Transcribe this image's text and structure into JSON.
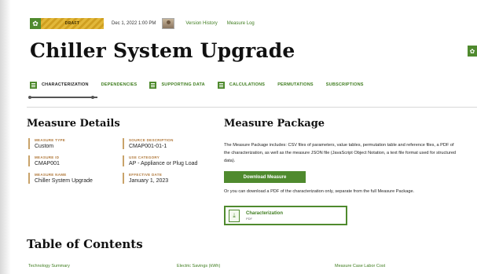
{
  "topbar": {
    "status_badge": "DRAFT",
    "datetime": "Dec 1, 2022 1:00 PM",
    "version_history_label": "Version History",
    "measure_log_label": "Measure Log"
  },
  "page": {
    "title": "Chiller System Upgrade"
  },
  "tabs": [
    {
      "label": "CHARACTERIZATION",
      "has_icon": true,
      "active": true
    },
    {
      "label": "DEPENDENCIES",
      "has_icon": false
    },
    {
      "label": "SUPPORTING DATA",
      "has_icon": true
    },
    {
      "label": "CALCULATIONS",
      "has_icon": true
    },
    {
      "label": "PERMUTATIONS",
      "has_icon": false
    },
    {
      "label": "SUBSCRIPTIONS",
      "has_icon": false
    }
  ],
  "measure_details": {
    "heading": "Measure Details",
    "fields": [
      {
        "label": "MEASURE TYPE",
        "value": "Custom"
      },
      {
        "label": "MEASURE ID",
        "value": "CMAP001"
      },
      {
        "label": "MEASURE NAME",
        "value": "Chiller System Upgrade"
      },
      {
        "label": "SOURCE DESCRIPTION",
        "value": "CMAP001-01-1"
      },
      {
        "label": "USE CATEGORY",
        "value": "AP - Appliance or Plug Load"
      },
      {
        "label": "EFFECTIVE DATE",
        "value": "January 1, 2023"
      }
    ]
  },
  "measure_package": {
    "heading": "Measure Package",
    "description": "The Measure Package includes: CSV files of parameters, value tables, permutation table and reference files, a PDF of the characterization, as well as the measure JSON file (JavaScript Object Notation, a text file format used for structured data).",
    "download_label": "Download Measure",
    "alt_text": "Or you can download a PDF of the characterization only, separate from the full Measure Package.",
    "pdf_card": {
      "title": "Characterization",
      "subtitle": "PDF"
    }
  },
  "toc": {
    "heading": "Table of Contents",
    "links": [
      "Technology Summary",
      "Electric Savings (kWh)",
      "Measure Case Labor Cost"
    ]
  },
  "colors": {
    "brand_green": "#4f8a2e",
    "link_green": "#3f7d1f",
    "label_tan": "#b0783a",
    "draft_yellow": "#e2b83a"
  },
  "icons": {
    "settings": "gear-icon",
    "tab_icon": "list-icon",
    "pdf": "pdf-download-icon"
  }
}
